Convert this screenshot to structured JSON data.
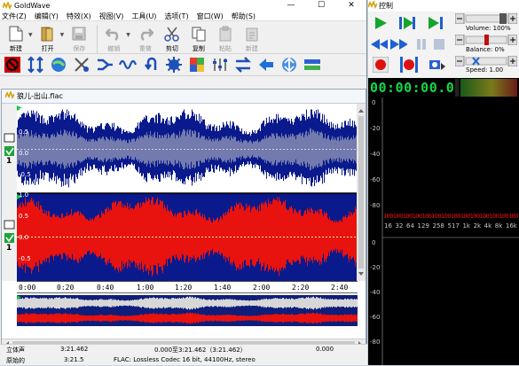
{
  "app": {
    "title": "GoldWave"
  },
  "window_buttons": [
    "—",
    "☐",
    "✕"
  ],
  "menu": [
    "文件(Z)",
    "编辑(Y)",
    "特效(X)",
    "视图(V)",
    "工具(U)",
    "选项(T)",
    "窗口(W)",
    "帮助(S)"
  ],
  "toolbar": {
    "new": "新建",
    "open": "打开",
    "save": "保存",
    "undo": "撤销",
    "redo": "重做",
    "cut": "剪切",
    "copy": "复制",
    "paste": "粘贴",
    "new_paste": "新建"
  },
  "document": {
    "title": "狼儿-出山.flac"
  },
  "timeline": [
    "0:00",
    "0:20",
    "0:40",
    "1:00",
    "1:20",
    "1:40",
    "2:00",
    "2:20",
    "2:40"
  ],
  "amplitude_labels": {
    "top": [
      "1.0",
      "0.5",
      "0.0",
      "-0.5"
    ],
    "bottom": [
      "1.0",
      "0.5",
      "0.0",
      "-0.5"
    ]
  },
  "status": {
    "row1": {
      "channels": "立体声",
      "length": "3:21.462",
      "selection": "0.000至3:21.462（3:21.462）",
      "position": "0.000"
    },
    "row2": {
      "state": "原始的",
      "duration": "3:21.5",
      "format": "FLAC: Lossless Codec 16 bit, 44100Hz, stereo"
    }
  },
  "control": {
    "title": "控制",
    "time": "00:00:00.0",
    "volume_label": "Volume: 100%",
    "balance_label": "Balance: 0%",
    "speed_label": "Speed: 1.00",
    "volume_value": 1.0,
    "balance_value": 0.0,
    "speed_value": 1.0
  },
  "spectrum": {
    "db_upper": [
      "0",
      "-20",
      "-40",
      "-60",
      "-80"
    ],
    "peak_values": [
      "100",
      "100",
      "100",
      "100",
      "100",
      "100",
      "100",
      "100",
      "100",
      "100",
      "100",
      "100",
      "100",
      "100",
      "100",
      "100"
    ],
    "freq_labels": [
      "16",
      "32",
      "64",
      "129",
      "258",
      "517",
      "1k",
      "2k",
      "4k",
      "8k",
      "16k"
    ],
    "db_lower": [
      "0",
      "-20",
      "-40",
      "-60",
      "-80"
    ]
  },
  "colors": {
    "waveform_blue": "#0a1a8c",
    "waveform_red": "#e8120f",
    "waveform_bg": "#ffffff",
    "selection_bg": "#2a2a2a",
    "time_display": "#12d94a",
    "spectrum_peak": "#e01010"
  }
}
